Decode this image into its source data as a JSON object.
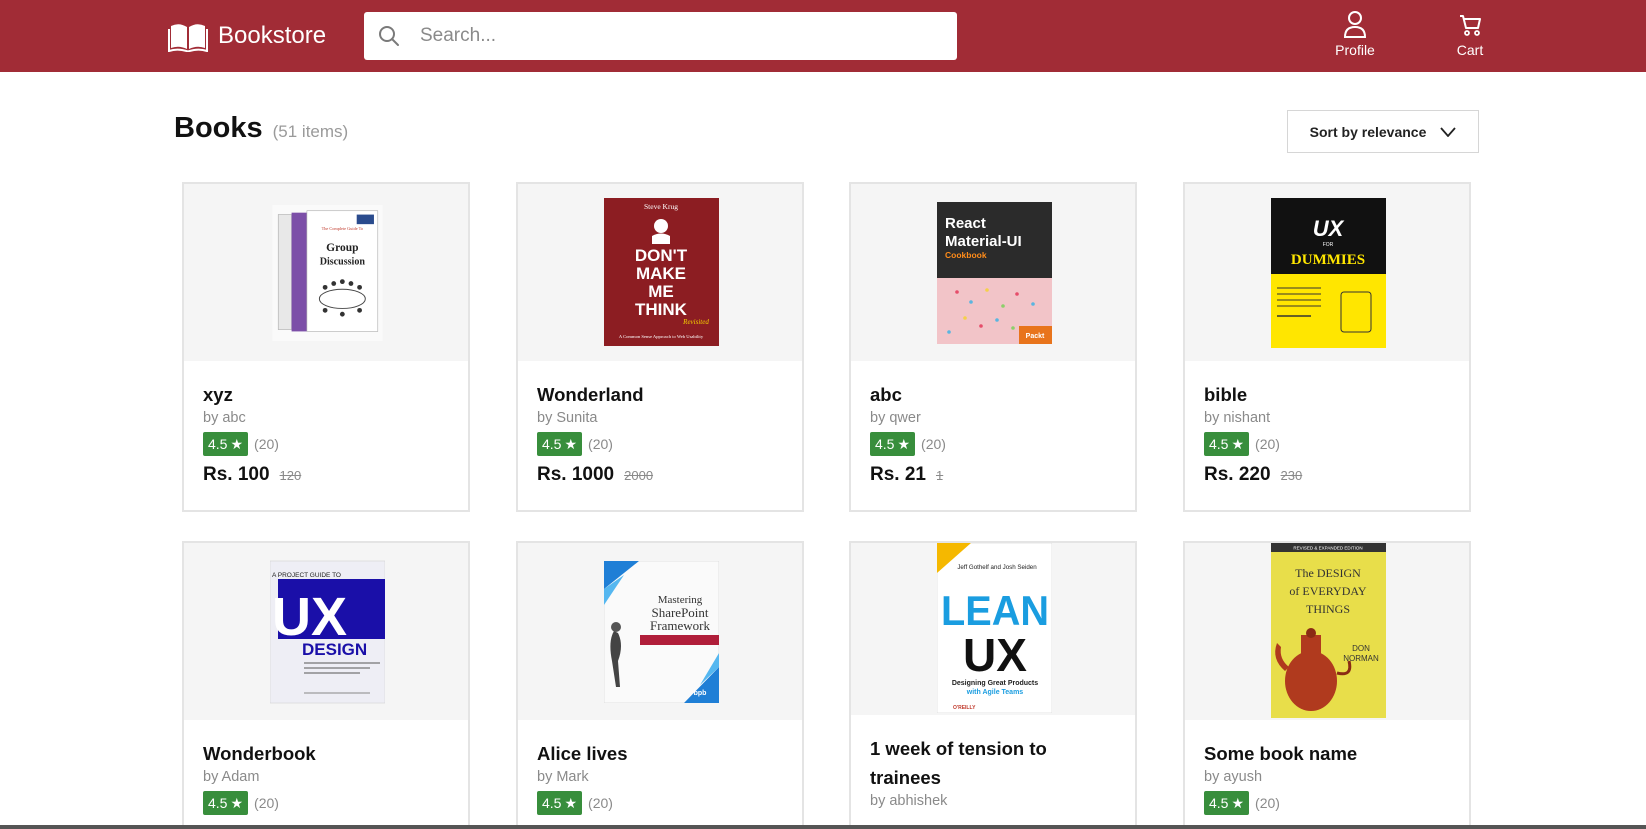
{
  "header": {
    "brand": "Bookstore",
    "search_placeholder": "Search...",
    "profile_label": "Profile",
    "cart_label": "Cart",
    "color": "#a12c36"
  },
  "listing": {
    "title": "Books",
    "count": "(51 items)",
    "sort_label": "Sort by relevance"
  },
  "books": [
    {
      "title": "xyz",
      "author": "by abc",
      "rating": "4.5",
      "reviews": "(20)",
      "price": "Rs. 100",
      "original_price": "120",
      "cover": {
        "lines": [
          "The Complete Guide To",
          "Group",
          "Discussion"
        ]
      }
    },
    {
      "title": "Wonderland",
      "author": "by Sunita",
      "rating": "4.5",
      "reviews": "(20)",
      "price": "Rs. 1000",
      "original_price": "2000",
      "cover": {
        "lines": [
          "Steve Krug",
          "DON'T",
          "MAKE",
          "ME",
          "THINK",
          "Revisited",
          "A Common Sense Approach to Web Usability"
        ]
      }
    },
    {
      "title": "abc",
      "author": "by qwer",
      "rating": "4.5",
      "reviews": "(20)",
      "price": "Rs. 21",
      "original_price": "1",
      "cover": {
        "lines": [
          "React",
          "Material-UI",
          "Cookbook",
          "Packt"
        ]
      }
    },
    {
      "title": "bible",
      "author": "by nishant",
      "rating": "4.5",
      "reviews": "(20)",
      "price": "Rs. 220",
      "original_price": "230",
      "cover": {
        "lines": [
          "UX",
          "FOR",
          "DUMMIES"
        ]
      }
    },
    {
      "title": "Wonderbook",
      "author": "by Adam",
      "rating": "4.5",
      "reviews": "(20)",
      "cover": {
        "lines": [
          "A PROJECT GUIDE TO",
          "UX",
          "DESIGN"
        ]
      }
    },
    {
      "title": "Alice lives",
      "author": "by Mark",
      "rating": "4.5",
      "reviews": "(20)",
      "cover": {
        "lines": [
          "Mastering",
          "SharePoint",
          "Framework",
          "bpb"
        ]
      }
    },
    {
      "title": "1 week of tension to trainees",
      "author": "by abhishek",
      "cover": {
        "lines": [
          "Jeff Gothelf and Josh Seiden",
          "LEAN",
          "UX",
          "Designing Great Products",
          "with Agile Teams",
          "O'REILLY"
        ]
      }
    },
    {
      "title": "Some book name",
      "author": "by ayush",
      "rating": "4.5",
      "reviews": "(20)",
      "cover": {
        "lines": [
          "REVISED & EXPANDED EDITION",
          "The DESIGN",
          "of EVERYDAY",
          "THINGS",
          "DON",
          "NORMAN"
        ]
      }
    }
  ]
}
